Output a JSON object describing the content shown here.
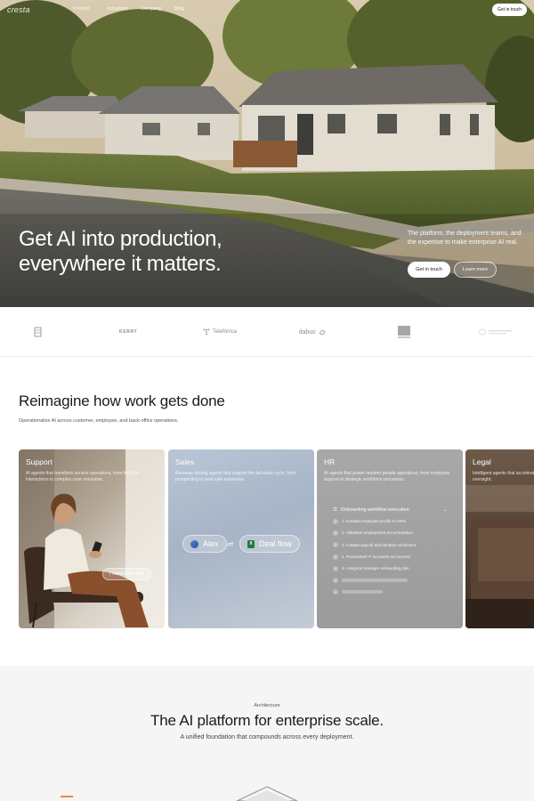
{
  "nav": {
    "logo": "cresta",
    "links": [
      "Product",
      "Industries",
      "Company",
      "Blog"
    ],
    "cta": "Get in touch"
  },
  "hero": {
    "title_line1": "Get AI into production,",
    "title_line2": "everywhere it matters.",
    "side_text": "The platform, the deployment teams, and the expertise to make enterprise AI real.",
    "primary_button": "Get in touch",
    "secondary_button": "Learn more"
  },
  "logos": [
    "KERRY",
    "Telefónica",
    "itabus"
  ],
  "reimagine": {
    "title": "Reimagine how work gets done",
    "subtitle": "Operationalize AI across customer, employee, and back-office operations."
  },
  "cards": {
    "support": {
      "title": "Support",
      "desc": "AI agents that transform service operations, from frontline interactions to complex case resolution.",
      "bubble": "I need help with"
    },
    "sales": {
      "title": "Sales",
      "desc": "Revenue-driving agents that support the full sales cycle, from prospecting to post-sale expansion.",
      "pill_alex": "Alex",
      "pill_deal": "Deal flow"
    },
    "hr": {
      "title": "HR",
      "desc": "AI agents that power modern people operations, from employee support to strategic workforce processes.",
      "workflow_title": "Onboarding workflow execution",
      "steps": [
        "1.  Created employee profile in HRIS",
        "2.  Validated employment documentation",
        "3.  Initiated payroll and benefits enrollment",
        "4.  Provisioned IT accounts and access",
        "5.  Assigned manager onboarding plan"
      ]
    },
    "legal": {
      "title": "Legal",
      "desc": "Intelligent agents that accelerate legal work while maintaining oversight."
    }
  },
  "architecture": {
    "eyebrow": "Architecture",
    "title": "The AI platform for enterprise scale.",
    "subtitle": "A unified foundation that compounds across every deployment."
  },
  "colors": {
    "accent": "#ffffff",
    "text": "#1a1a1a",
    "excel_green": "#1f7a44"
  }
}
